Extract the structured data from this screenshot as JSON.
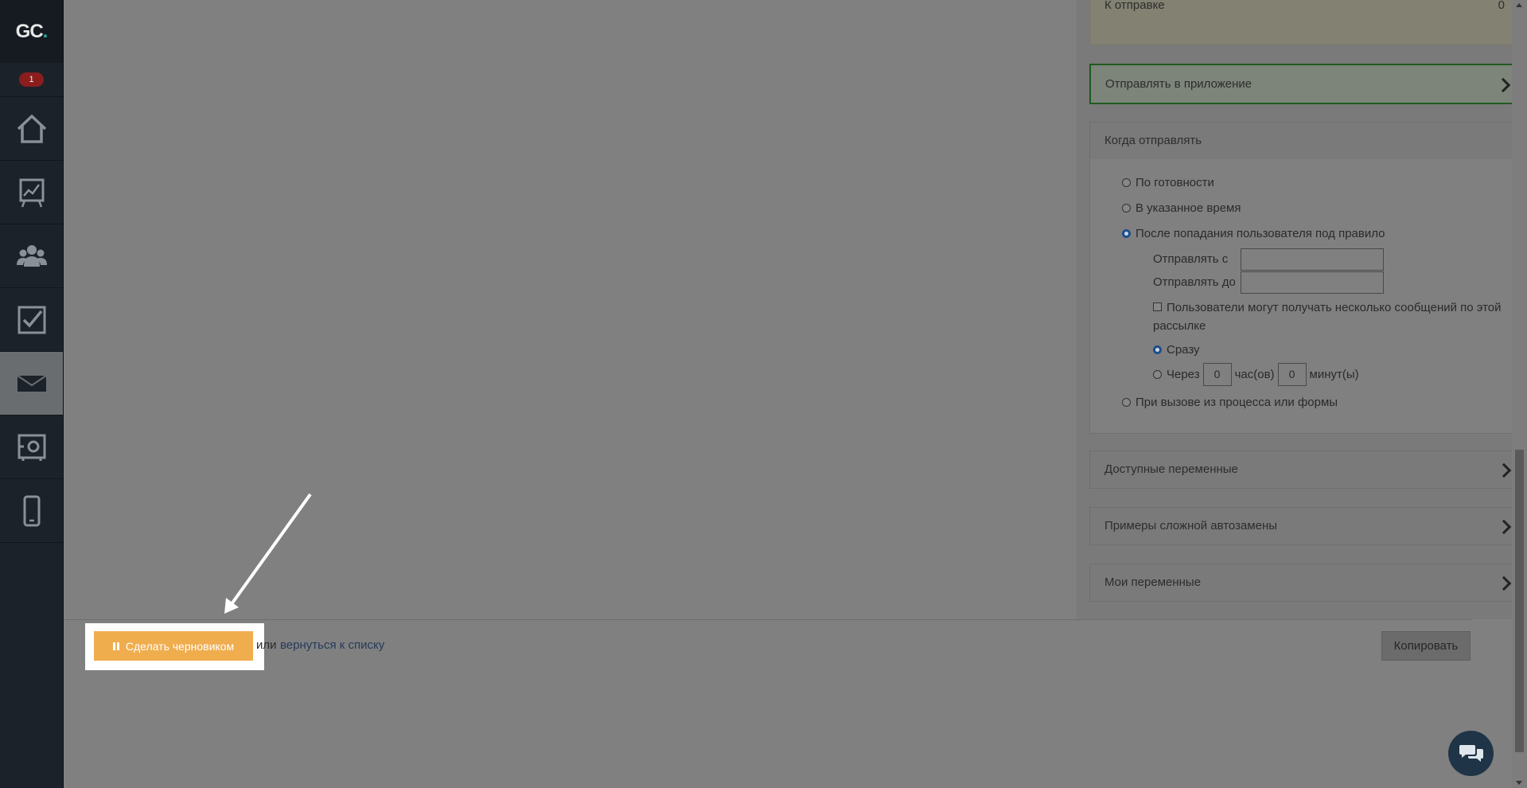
{
  "sidebar": {
    "logo_text": "GC",
    "logo_dot": ".",
    "notification_count": "1",
    "items": [
      {
        "name": "home-icon"
      },
      {
        "name": "chart-board-icon"
      },
      {
        "name": "users-icon"
      },
      {
        "name": "checkbox-icon"
      },
      {
        "name": "envelope-icon",
        "active": true
      },
      {
        "name": "safe-icon"
      },
      {
        "name": "mobile-icon"
      }
    ]
  },
  "right_panel": {
    "top_box_label": "К отправке",
    "top_box_value": "0",
    "send_to_app": "Отправлять в приложение",
    "when_to_send": {
      "title": "Когда отправлять",
      "options": [
        "По готовности",
        "В указанное время",
        "После попадания пользователя под правило"
      ],
      "selected_option": "После попадания пользователя под правило",
      "send_from_label": "Отправлять с",
      "send_from_value": "",
      "send_to_label": "Отправлять до",
      "send_to_value": "",
      "multiple_messages_label": "Пользователи могут получать несколько сообщений по этой рассылке",
      "multiple_messages_checked": false,
      "immediately_label": "Сразу",
      "after_label": "Через",
      "hours_value": "0",
      "hours_label": "час(ов)",
      "minutes_value": "0",
      "minutes_label": "минут(ы)",
      "timing_selected": "Сразу",
      "process_option": "При вызове из процесса или формы"
    },
    "available_variables": "Доступные переменные",
    "complex_examples": "Примеры сложной автозамены",
    "my_variables": "Мои переменные"
  },
  "footer": {
    "draft_button": "Сделать черновиком",
    "or_text": "или",
    "back_link": "вернуться к списку",
    "copy_button": "Копировать"
  },
  "colors": {
    "draft_button": "#f0ad4e",
    "sidebar": "#1b222a",
    "overlay": "#808080",
    "link": "#263a5c"
  }
}
